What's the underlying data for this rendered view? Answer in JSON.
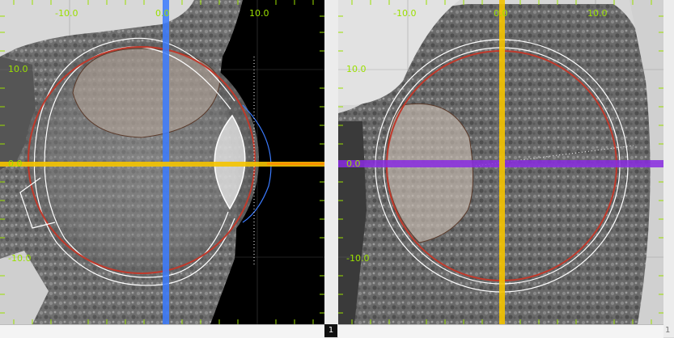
{
  "viewports": [
    {
      "id": "left",
      "orientation": "sagittal",
      "crosshair_colors": {
        "vertical": "#3b7bff",
        "horizontal": "#f5c400"
      },
      "x_tick_labels": [
        "-10.0",
        "0.0",
        "10.0"
      ],
      "y_tick_labels": [
        "10.0",
        "0.0",
        "-10.0"
      ],
      "index_label": "1"
    },
    {
      "id": "right",
      "orientation": "coronal",
      "crosshair_colors": {
        "vertical": "#f5c400",
        "horizontal": "#8a2be2"
      },
      "x_tick_labels": [
        "-10.0",
        "0.0",
        "10.0"
      ],
      "y_tick_labels": [
        "10.0",
        "0.0",
        "-10.0"
      ],
      "index_label": "1"
    }
  ],
  "colors": {
    "tick_label": "#9be000",
    "globe_contour": "#c0392b",
    "outer_contour": "#ffffff",
    "tumor_fill": "#b8a89a",
    "tumor_stroke": "#5a3a2a",
    "lens_stroke": "#ffffff",
    "cornea_stroke": "#3b7bff"
  },
  "icons": [
    "crosshair-vertical-icon",
    "crosshair-horizontal-icon"
  ]
}
